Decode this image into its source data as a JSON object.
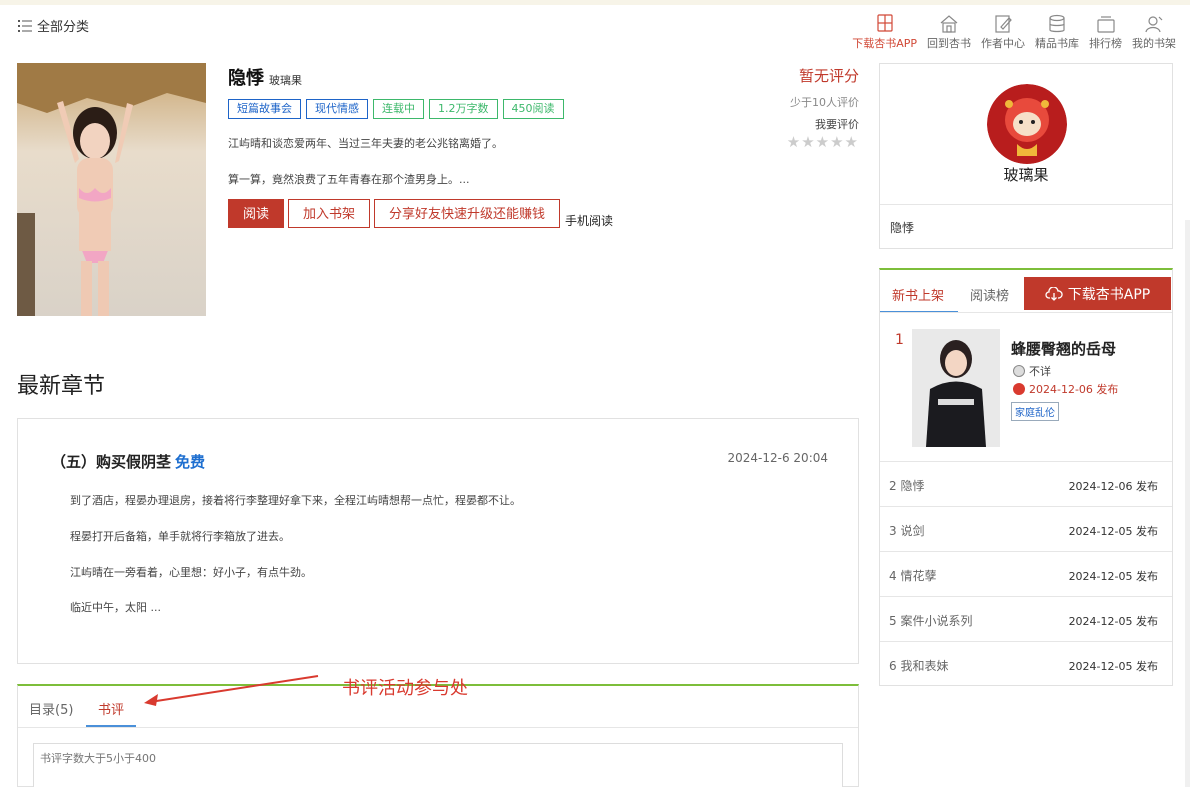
{
  "header": {
    "all_categories": "全部分类",
    "nav": [
      {
        "label": "下载杏书APP",
        "icon": "phone-book-icon",
        "active": true
      },
      {
        "label": "回到杏书",
        "icon": "home-icon",
        "active": false
      },
      {
        "label": "作者中心",
        "icon": "edit-icon",
        "active": false
      },
      {
        "label": "精品书库",
        "icon": "database-icon",
        "active": false
      },
      {
        "label": "排行榜",
        "icon": "ranking-icon",
        "active": false
      },
      {
        "label": "我的书架",
        "icon": "user-icon",
        "active": false
      }
    ]
  },
  "book": {
    "title": "隐悸",
    "author": "玻璃果",
    "tags": [
      {
        "label": "短篇故事会",
        "color": "blue"
      },
      {
        "label": "现代情感",
        "color": "blue"
      },
      {
        "label": "连载中",
        "color": "green"
      },
      {
        "label": "1.2万字数",
        "color": "green"
      },
      {
        "label": "450阅读",
        "color": "green"
      }
    ],
    "desc_line1": "江屿晴和谈恋爱两年、当过三年夫妻的老公兆铭离婚了。",
    "desc_line2": "算一算，竟然浪费了五年青春在那个渣男身上。...",
    "read_button": "阅读",
    "shelf_button": "加入书架",
    "share_button": "分享好友快速升级还能赚钱",
    "mobile_read": "手机阅读"
  },
  "rating": {
    "score_text": "暂无评分",
    "count_text": "少于10人评价",
    "rate_link": "我要评价",
    "stars": "★★★★★"
  },
  "latest": {
    "heading": "最新章节",
    "chapter_title": "（五）购买假阴茎",
    "free_label": "免费",
    "date": "2024-12-6 20:04",
    "paragraphs": [
      "到了酒店，程晏办理退房，接着将行李整理好拿下来，全程江屿晴想帮一点忙，程晏都不让。",
      "程晏打开后备箱，单手就将行李箱放了进去。",
      "江屿晴在一旁看着，心里想：好小子，有点牛劲。",
      "临近中午，太阳 ..."
    ]
  },
  "tabs": {
    "catalog": "目录(5)",
    "review": "书评",
    "review_placeholder": "书评字数大于5小于400",
    "annotation": "书评活动参与处"
  },
  "author_panel": {
    "name": "玻璃果",
    "book": "隐悸"
  },
  "ranking": {
    "tab_new": "新书上架",
    "tab_read": "阅读榜",
    "download_button": "下载杏书APP",
    "top": {
      "num": "1",
      "title": "蜂腰臀翘的岳母",
      "author": "不详",
      "date": "2024-12-06 发布",
      "tag": "家庭乱伦"
    },
    "items": [
      {
        "num": "2",
        "title": "隐悸",
        "date": "2024-12-06 发布"
      },
      {
        "num": "3",
        "title": "说剑",
        "date": "2024-12-05 发布"
      },
      {
        "num": "4",
        "title": "情花孽",
        "date": "2024-12-05 发布"
      },
      {
        "num": "5",
        "title": "案件小说系列",
        "date": "2024-12-05 发布"
      },
      {
        "num": "6",
        "title": "我和表妹",
        "date": "2024-12-05 发布"
      }
    ]
  },
  "colors": {
    "accent_red": "#c0392b",
    "tag_blue": "#1e64c8",
    "tag_green": "#3db86b",
    "border_green": "#7dbe3a"
  }
}
